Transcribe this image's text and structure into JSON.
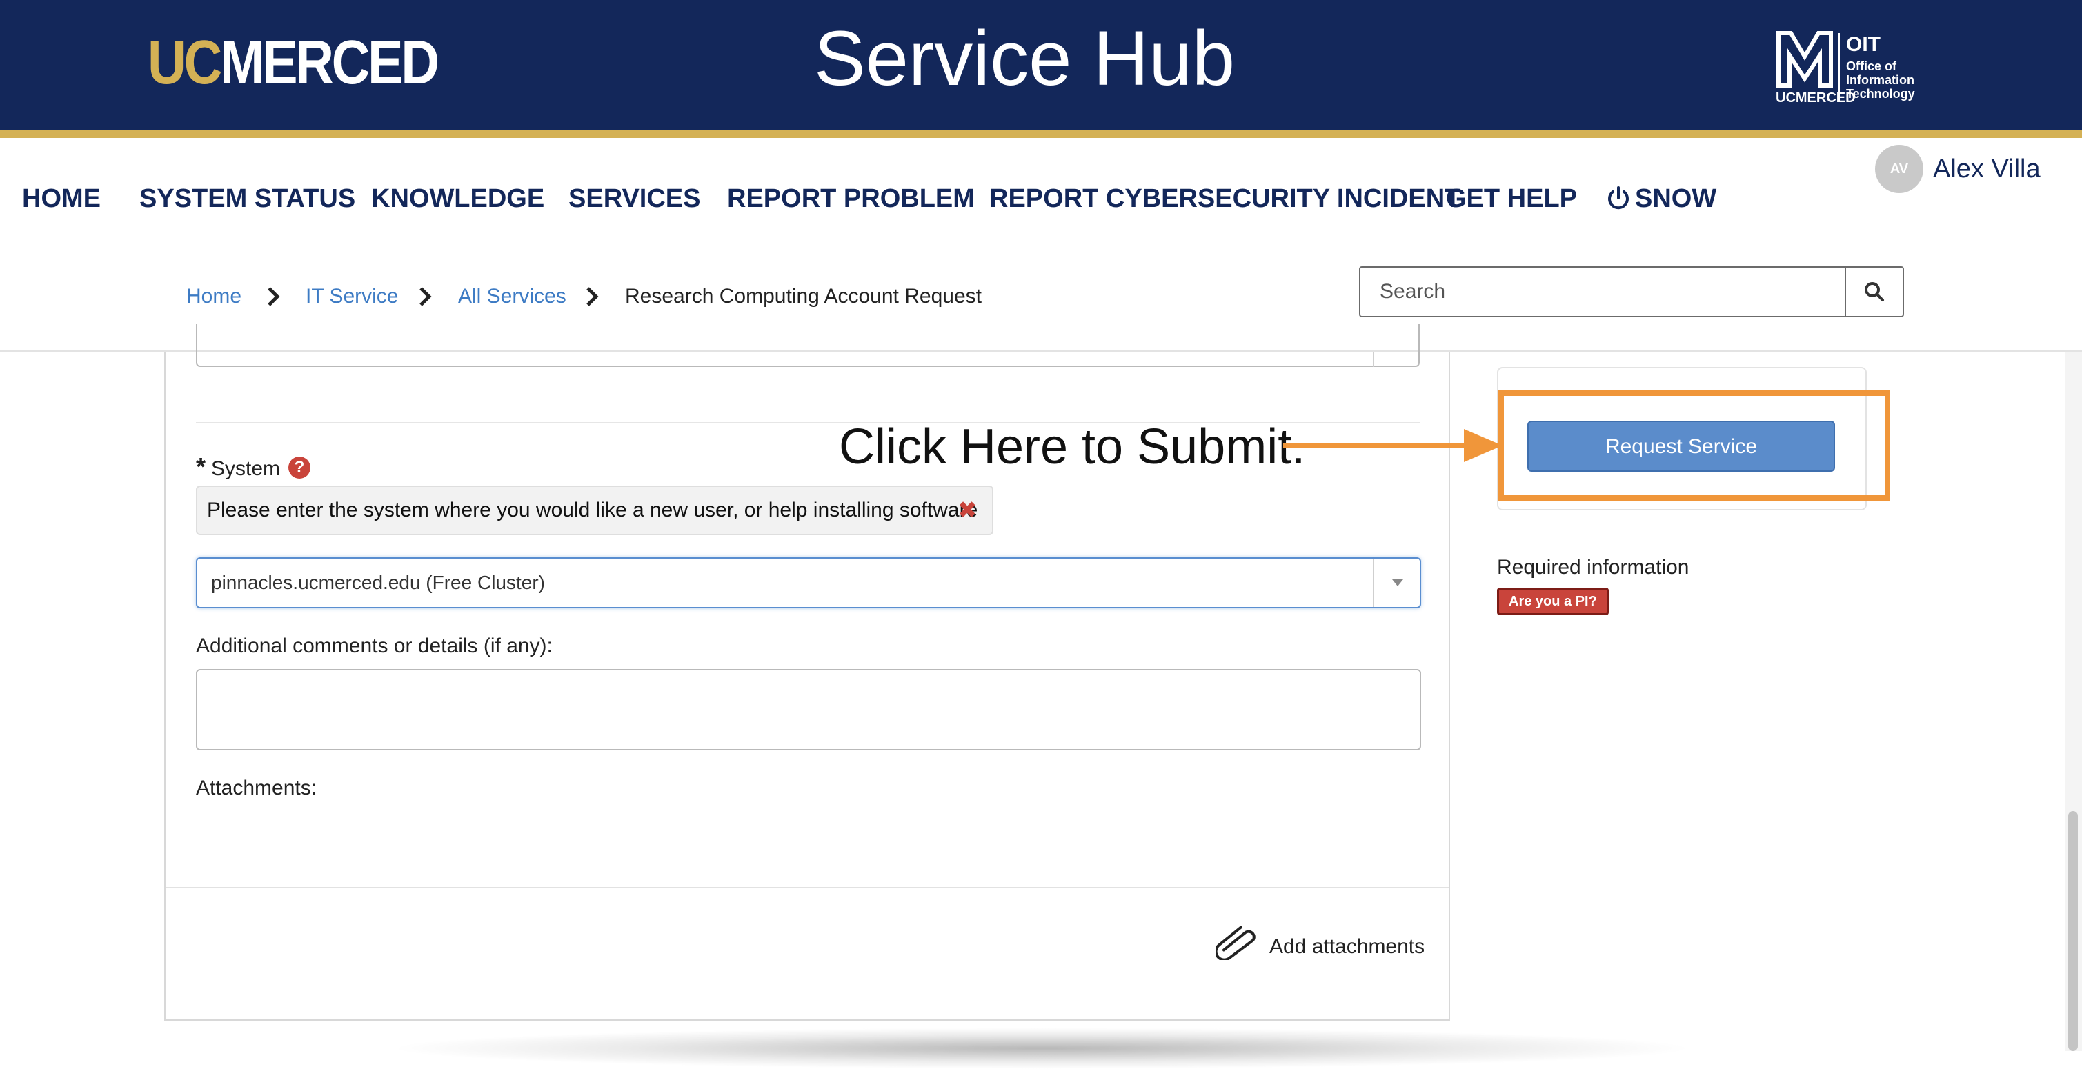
{
  "header": {
    "logo_uc": "UC",
    "logo_merced": "MERCED",
    "title": "Service Hub",
    "oit": {
      "name": "OIT",
      "line1": "Office of",
      "line2": "Information",
      "line3": "Technology",
      "sub": "UCMERCED"
    },
    "colors": {
      "navy": "#13275a",
      "gold": "#d4b155"
    }
  },
  "nav": {
    "items": [
      {
        "label": "HOME"
      },
      {
        "label": "SYSTEM STATUS"
      },
      {
        "label": "KNOWLEDGE"
      },
      {
        "label": "SERVICES"
      },
      {
        "label": "REPORT PROBLEM"
      },
      {
        "label": "REPORT CYBERSECURITY INCIDENT"
      },
      {
        "label": "GET HELP"
      },
      {
        "label": "SNOW",
        "icon": "power-icon"
      }
    ]
  },
  "user": {
    "initials": "AV",
    "name": "Alex Villa"
  },
  "breadcrumb": {
    "items": [
      {
        "label": "Home"
      },
      {
        "label": "IT Service"
      },
      {
        "label": "All Services"
      },
      {
        "label": "Research Computing Account Request"
      }
    ]
  },
  "search": {
    "placeholder": "Search",
    "icon": "search-icon"
  },
  "form": {
    "system": {
      "required_marker": "*",
      "label": "System",
      "help_icon": "?",
      "error_message": "Please enter the system where you would like a new user, or help installing software",
      "error_clear_icon": "✖",
      "selected_value": "pinnacles.ucmerced.edu (Free Cluster)"
    },
    "comments": {
      "label": "Additional comments or details (if any):",
      "value": ""
    },
    "attachments": {
      "label": "Attachments:",
      "add_label": "Add attachments",
      "icon": "paperclip-icon"
    }
  },
  "sidebar": {
    "request_button": "Request Service",
    "required_info_label": "Required information",
    "required_badge": "Are you a PI?"
  },
  "annotation": {
    "text": "Click Here to Submit.",
    "color": "#f0963a"
  }
}
